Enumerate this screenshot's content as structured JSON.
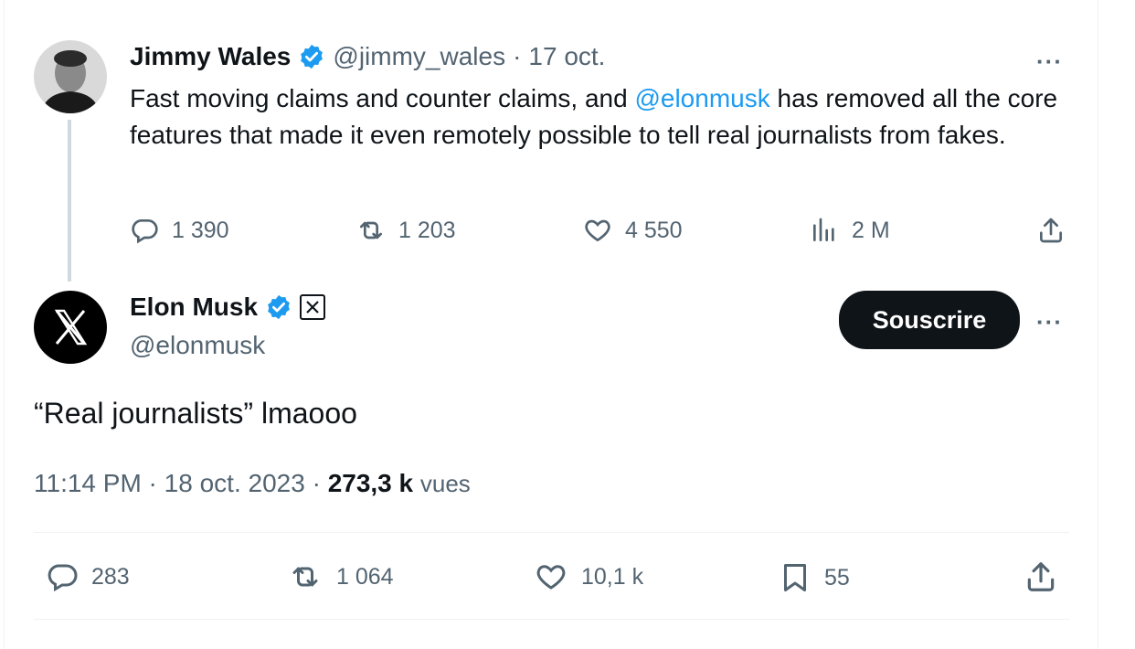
{
  "parent_tweet": {
    "display_name": "Jimmy Wales",
    "handle": "@jimmy_wales",
    "separator": "·",
    "date": "17 oct.",
    "text_before": "Fast moving claims and counter claims, and ",
    "mention": "@elonmusk",
    "text_after": " has removed all the core features that made it even remotely possible to tell real journalists from fakes.",
    "more_label": "···",
    "actions": {
      "replies": "1 390",
      "retweets": "1 203",
      "likes": "4 550",
      "views": "2 M"
    }
  },
  "main_tweet": {
    "display_name": "Elon Musk",
    "handle": "@elonmusk",
    "subscribe_label": "Souscrire",
    "more_label": "···",
    "text": "“Real journalists” lmaooo",
    "time": "11:14 PM",
    "separator1": " · ",
    "date": "18 oct. 2023",
    "separator2": " · ",
    "views_count": "273,3 k",
    "views_label": "vues",
    "actions": {
      "replies": "283",
      "retweets": "1 064",
      "likes": "10,1 k",
      "bookmarks": "55"
    }
  },
  "colors": {
    "accent": "#1d9bf0",
    "text": "#0f1419",
    "muted": "#536471",
    "button": "#0f1419",
    "thread_line": "#cfd9de"
  },
  "icons": [
    "reply-icon",
    "retweet-icon",
    "like-icon",
    "views-icon",
    "share-icon",
    "bookmark-icon",
    "verified-badge-icon",
    "x-logo-icon"
  ]
}
